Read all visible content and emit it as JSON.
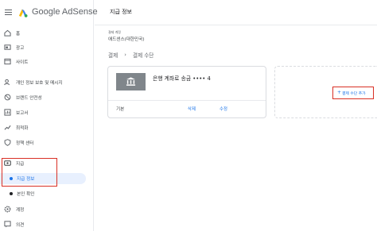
{
  "app": {
    "brand": "Google AdSense"
  },
  "sidebar": {
    "items": [
      {
        "label": "홈",
        "icon": "home-icon"
      },
      {
        "label": "광고",
        "icon": "ads-icon"
      },
      {
        "label": "사이트",
        "icon": "sites-icon"
      },
      {
        "label": "개인 정보 보호 및 메시지",
        "icon": "privacy-icon"
      },
      {
        "label": "브랜드 안전성",
        "icon": "brand-safety-icon"
      },
      {
        "label": "보고서",
        "icon": "reports-icon"
      },
      {
        "label": "최적화",
        "icon": "optimization-icon"
      },
      {
        "label": "정책 센터",
        "icon": "policy-icon"
      },
      {
        "label": "지급",
        "icon": "payments-icon"
      },
      {
        "label": "계정",
        "icon": "account-icon"
      },
      {
        "label": "의견",
        "icon": "feedback-icon"
      }
    ],
    "subitems": [
      {
        "label": "지급 정보",
        "active": true
      },
      {
        "label": "본인 확인",
        "active": false
      }
    ]
  },
  "header": {
    "title": "지급 정보"
  },
  "account": {
    "caption": "결제 계정",
    "name": "애드센스(대한민국)"
  },
  "breadcrumb": {
    "parent": "결제",
    "current": "결제 수단"
  },
  "payment_card": {
    "method": "은행 계좌로 송금 •••• 4",
    "label": "기본",
    "remove_label": "삭제",
    "edit_label": "수정"
  },
  "add_method": {
    "label": "결제 수단 추가",
    "icon": "plus-icon"
  },
  "colors": {
    "accent": "#1a73e8",
    "highlight": "#d93025",
    "active_bg": "#e8f0fe",
    "bank_tile": "#80868b"
  }
}
